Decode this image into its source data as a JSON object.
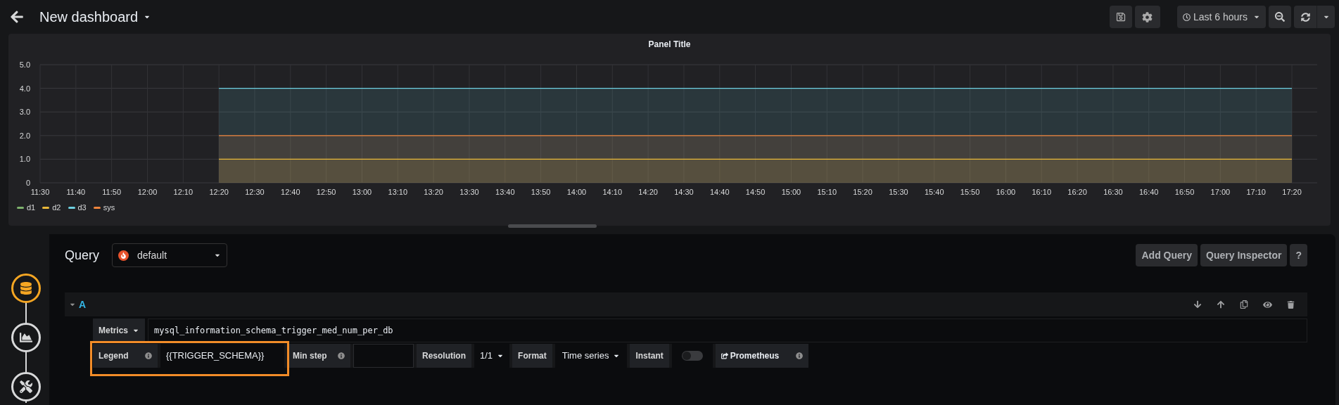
{
  "header": {
    "title": "New dashboard",
    "time_range": "Last 6 hours"
  },
  "panel": {
    "title": "Panel Title",
    "chart_data": {
      "type": "area",
      "categories": [
        "11:30",
        "11:40",
        "11:50",
        "12:00",
        "12:10",
        "12:20",
        "12:30",
        "12:40",
        "12:50",
        "13:00",
        "13:10",
        "13:20",
        "13:30",
        "13:40",
        "13:50",
        "14:00",
        "14:10",
        "14:20",
        "14:30",
        "14:40",
        "14:50",
        "15:00",
        "15:10",
        "15:20",
        "15:30",
        "15:40",
        "15:50",
        "16:00",
        "16:10",
        "16:20",
        "16:30",
        "16:40",
        "16:50",
        "17:00",
        "17:10",
        "17:20"
      ],
      "series": [
        {
          "name": "d1",
          "color": "#7eb26d",
          "values": [
            null,
            null,
            null,
            null,
            null,
            null,
            null,
            null,
            null,
            null,
            null,
            null,
            null,
            null,
            null,
            null,
            null,
            null,
            null,
            null,
            null,
            null,
            null,
            null,
            null,
            null,
            null,
            null,
            null,
            null,
            null,
            null,
            null,
            null,
            null,
            null
          ]
        },
        {
          "name": "d2",
          "color": "#eab839",
          "values": [
            null,
            null,
            null,
            null,
            null,
            1,
            1,
            1,
            1,
            1,
            1,
            1,
            1,
            1,
            1,
            1,
            1,
            1,
            1,
            1,
            1,
            1,
            1,
            1,
            1,
            1,
            1,
            1,
            1,
            1,
            1,
            1,
            1,
            1,
            1,
            1
          ]
        },
        {
          "name": "d3",
          "color": "#6ed0e0",
          "values": [
            null,
            null,
            null,
            null,
            null,
            4,
            4,
            4,
            4,
            4,
            4,
            4,
            4,
            4,
            4,
            4,
            4,
            4,
            4,
            4,
            4,
            4,
            4,
            4,
            4,
            4,
            4,
            4,
            4,
            4,
            4,
            4,
            4,
            4,
            4,
            4
          ]
        },
        {
          "name": "sys",
          "color": "#ef843c",
          "values": [
            null,
            null,
            null,
            null,
            null,
            2,
            2,
            2,
            2,
            2,
            2,
            2,
            2,
            2,
            2,
            2,
            2,
            2,
            2,
            2,
            2,
            2,
            2,
            2,
            2,
            2,
            2,
            2,
            2,
            2,
            2,
            2,
            2,
            2,
            2,
            2
          ]
        }
      ],
      "ylim": [
        0,
        5
      ],
      "grid": true,
      "yticks": [
        {
          "value": 0,
          "label": "0"
        },
        {
          "value": 1,
          "label": "1.0"
        },
        {
          "value": 2,
          "label": "2.0"
        },
        {
          "value": 3,
          "label": "3.0"
        },
        {
          "value": 4,
          "label": "4.0"
        },
        {
          "value": 5,
          "label": "5.0"
        }
      ]
    }
  },
  "query_editor": {
    "title": "Query",
    "datasource": "default",
    "buttons": [
      "Add Query",
      "Query Inspector",
      "?"
    ],
    "steps": [
      {
        "kind": "queries",
        "selected": true
      },
      {
        "kind": "visualization",
        "selected": false
      },
      {
        "kind": "general",
        "selected": false
      }
    ],
    "query": {
      "ref": "A",
      "expanded": true,
      "metrics_label": "Metrics",
      "metrics": "mysql_information_schema_trigger_med_num_per_db",
      "legend_label": "Legend",
      "legend_value": "{{TRIGGER_SCHEMA}}",
      "min_step_label": "Min step",
      "resolution_label": "Resolution",
      "resolution": "1/1",
      "format_label": "Format",
      "format": "Time series",
      "instant_label": "Instant",
      "instant": false,
      "link": "Prometheus"
    }
  }
}
